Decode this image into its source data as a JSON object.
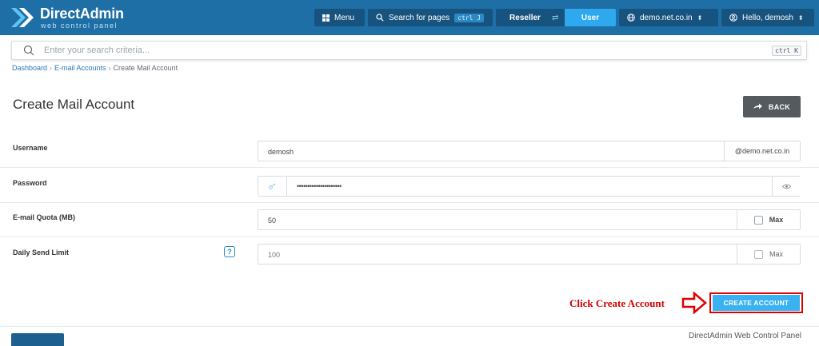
{
  "brand": {
    "title": "DirectAdmin",
    "subtitle": "web control panel"
  },
  "topbar": {
    "menu_label": "Menu",
    "search_label": "Search for pages",
    "search_shortcut": "ctrl J",
    "level_reseller": "Reseller",
    "level_user": "User",
    "domain_label": "demo.net.co.in",
    "greeting": "Hello, demosh"
  },
  "search": {
    "placeholder": "Enter your search criteria...",
    "shortcut": "ctrl K"
  },
  "breadcrumb": {
    "items": [
      "Dashboard",
      "E-mail Accounts",
      "Create Mail Account"
    ]
  },
  "page": {
    "title": "Create Mail Account",
    "back_label": "BACK"
  },
  "form": {
    "username": {
      "label": "Username",
      "value": "demosh",
      "suffix": "@demo.net.co.in"
    },
    "password": {
      "label": "Password",
      "value": "•••••••••••••••••••••"
    },
    "quota": {
      "label": "E-mail Quota (MB)",
      "value": "50",
      "max_label": "Max"
    },
    "send_limit": {
      "label": "Daily Send Limit",
      "value": "100",
      "max_label": "Max",
      "help": "?"
    }
  },
  "annotation": {
    "text": "Click Create Account",
    "color": "#d40000"
  },
  "create_label": "CREATE ACCOUNT",
  "footer": {
    "text": "DirectAdmin Web Control Panel"
  },
  "colors": {
    "topbar": "#1e6fa6",
    "accent": "#2ea8ee",
    "create": "#3ab1f0",
    "annotation": "#e00000"
  }
}
